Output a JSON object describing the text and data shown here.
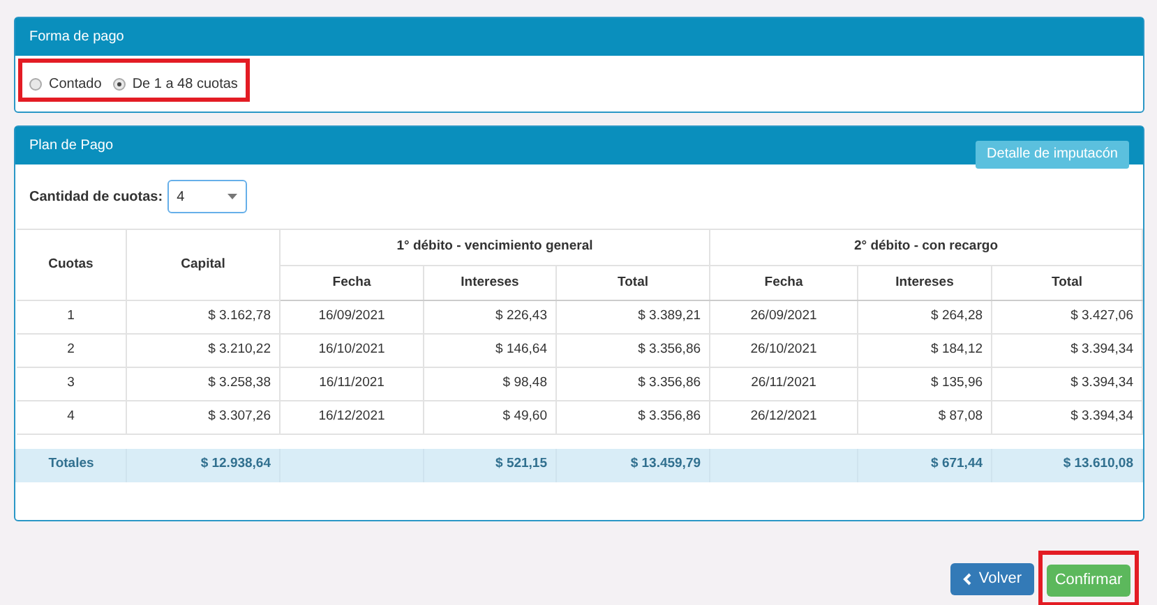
{
  "payment_panel": {
    "title": "Forma de pago",
    "options": [
      {
        "label": "Contado",
        "selected": false
      },
      {
        "label": "De 1 a 48 cuotas",
        "selected": true
      }
    ]
  },
  "plan_panel": {
    "title": "Plan de Pago",
    "detail_button": "Detalle de imputacón",
    "installments_label": "Cantidad de cuotas:",
    "installments_value": "4",
    "table": {
      "col_cuotas": "Cuotas",
      "col_capital": "Capital",
      "groups": [
        {
          "title": "1° débito - vencimiento general",
          "columns": [
            "Fecha",
            "Intereses",
            "Total"
          ]
        },
        {
          "title": "2° débito - con recargo",
          "columns": [
            "Fecha",
            "Intereses",
            "Total"
          ]
        }
      ],
      "rows": [
        [
          "1",
          "$ 3.162,78",
          "16/09/2021",
          "$ 226,43",
          "$ 3.389,21",
          "26/09/2021",
          "$ 264,28",
          "$ 3.427,06"
        ],
        [
          "2",
          "$ 3.210,22",
          "16/10/2021",
          "$ 146,64",
          "$ 3.356,86",
          "26/10/2021",
          "$ 184,12",
          "$ 3.394,34"
        ],
        [
          "3",
          "$ 3.258,38",
          "16/11/2021",
          "$ 98,48",
          "$ 3.356,86",
          "26/11/2021",
          "$ 135,96",
          "$ 3.394,34"
        ],
        [
          "4",
          "$ 3.307,26",
          "16/12/2021",
          "$ 49,60",
          "$ 3.356,86",
          "26/12/2021",
          "$ 87,08",
          "$ 3.394,34"
        ]
      ],
      "totals": {
        "label": "Totales",
        "capital": "$ 12.938,64",
        "groups": [
          {
            "interests": "$ 521,15",
            "total": "$ 13.459,79"
          },
          {
            "interests": "$ 671,44",
            "total": "$ 13.610,08"
          }
        ]
      }
    }
  },
  "buttons": {
    "back": "Volver",
    "confirm": "Confirmar"
  }
}
